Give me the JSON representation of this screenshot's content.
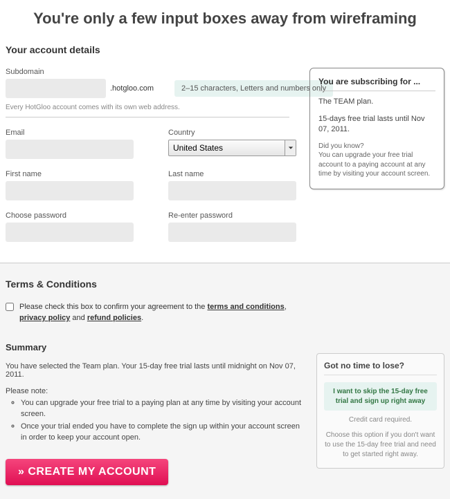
{
  "page_title": "You're only a few input boxes away from wireframing",
  "account": {
    "section_title": "Your account details",
    "subdomain_label": "Subdomain",
    "subdomain_suffix": ".hotgloo.com",
    "subdomain_hint": "2–15 characters, Letters and numbers only",
    "subdomain_note": "Every HotGloo account comes with its own web address.",
    "email_label": "Email",
    "country_label": "Country",
    "country_value": "United States",
    "firstname_label": "First name",
    "lastname_label": "Last name",
    "password_label": "Choose password",
    "repassword_label": "Re-enter password"
  },
  "subscribe": {
    "title": "You are subscribing for ...",
    "plan": "The TEAM plan.",
    "trial": "15-days free trial lasts until Nov 07, 2011.",
    "didyouknow_label": "Did you know?",
    "didyouknow_text": "You can upgrade your free trial account to a paying account at any time by visiting your account screen."
  },
  "terms": {
    "title": "Terms & Conditions",
    "text_prefix": "Please check this box to confirm your agreement to the ",
    "link1": "terms and conditions",
    "sep1": ", ",
    "link2": "privacy policy",
    "sep2": " and ",
    "link3": "refund policies",
    "suffix": "."
  },
  "summary": {
    "title": "Summary",
    "line": "You have selected the Team plan. Your 15-day free trial lasts until midnight on Nov 07, 2011.",
    "note_label": "Please note:",
    "note1": "You can upgrade your free trial to a paying plan at any time by visiting your account screen.",
    "note2": "Once your trial ended you have to complete the sign up within your account screen in order to keep your account open."
  },
  "skip": {
    "title": "Got no time to lose?",
    "action": "I want to skip the 15-day free trial and sign up right away",
    "cc": "Credit card required.",
    "desc": "Choose this option if you don't want to use the 15-day free trial and need to get started right away."
  },
  "create_button": "» CREATE MY ACCOUNT"
}
